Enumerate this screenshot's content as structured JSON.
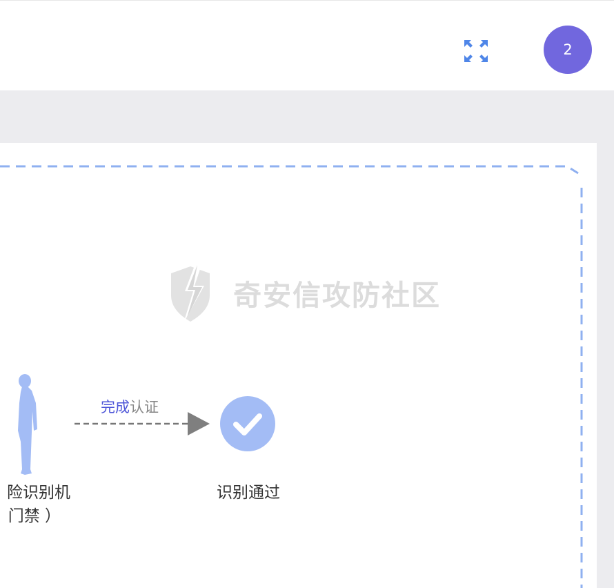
{
  "header": {
    "fullscreen_icon": "fullscreen-expand-icon",
    "avatar_text": "2",
    "avatar_color": "#7167de"
  },
  "watermark": {
    "text": "奇安信攻防社区",
    "logo_icon": "shield-lightning-icon"
  },
  "diagram": {
    "person_icon": "person-silhouette-icon",
    "left_label_line1": "险识别机",
    "left_label_line2": "门禁 ）",
    "arrow_label_highlight": "完成",
    "arrow_label_rest": "认证",
    "check_icon": "check-circle-icon",
    "pass_label": "识别通过",
    "accent_color": "#a3bcf5",
    "frame_color": "#8fb0f0"
  }
}
